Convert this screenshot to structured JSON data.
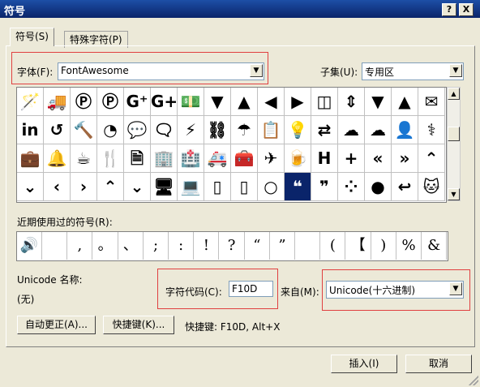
{
  "window": {
    "title": "符号",
    "help_label": "?",
    "close_label": "X"
  },
  "tabs": [
    {
      "label": "符号(S)"
    },
    {
      "label": "特殊字符(P)"
    }
  ],
  "font": {
    "label": "字体(F):",
    "value": "FontAwesome"
  },
  "subset": {
    "label": "子集(U):",
    "value": "专用区"
  },
  "symbol_grid": {
    "rows": [
      [
        "🪄",
        "🚚",
        "Ⓟ",
        "Ⓟ",
        "G⁺",
        "G+",
        "💵",
        "▼",
        "▲",
        "◀",
        "▶",
        "◫",
        "⇕",
        "▼",
        "▲",
        "✉"
      ],
      [
        "in",
        "↺",
        "🔨",
        "◔",
        "💬",
        "🗨",
        "⚡",
        "⛓",
        "☂",
        "📋",
        "💡",
        "⇄",
        "☁",
        "☁",
        "👤",
        "⚕"
      ],
      [
        "💼",
        "🔔",
        "☕",
        "🍴",
        "🗎",
        "🏢",
        "🏥",
        "🚑",
        "🧰",
        "✈",
        "🍺",
        "H",
        "+",
        "«",
        "»",
        "⌃"
      ],
      [
        "⌄",
        "‹",
        "›",
        "⌃",
        "⌄",
        "🖥",
        "💻",
        "▯",
        "▯",
        "○",
        "❝",
        "❞",
        "⁘",
        "●",
        "↩",
        "🐱"
      ]
    ],
    "selected": {
      "row": 3,
      "col": 10
    }
  },
  "recent": {
    "label": "近期使用过的符号(R):",
    "items": [
      "🔊",
      "",
      ",",
      "。",
      "、",
      ";",
      ":",
      "!",
      "?",
      "“",
      "”",
      "",
      "(",
      "【",
      ")",
      "%",
      "&"
    ]
  },
  "unicode_name": {
    "label": "Unicode 名称:",
    "value": "(无)"
  },
  "char_code": {
    "label": "字符代码(C):",
    "value": "F10D"
  },
  "from": {
    "label": "来自(M):",
    "value": "Unicode(十六进制)"
  },
  "buttons": {
    "autocorrect": "自动更正(A)...",
    "shortcut": "快捷键(K)...",
    "shortcut_text": "快捷键: F10D, Alt+X",
    "insert": "插入(I)",
    "cancel": "取消"
  },
  "accent_colors": {
    "selection": "#0a246a",
    "highlight_box": "#e04040"
  }
}
